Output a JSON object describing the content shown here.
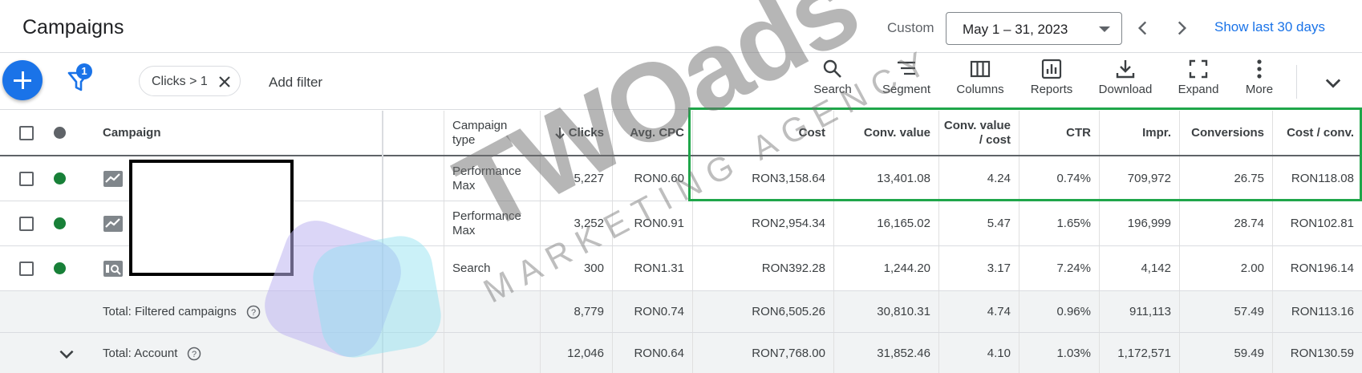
{
  "header": {
    "title": "Campaigns",
    "custom_label": "Custom",
    "date_range": "May 1 – 31, 2023",
    "show_last": "Show last 30 days"
  },
  "toolbar": {
    "filter_count": "1",
    "filter_chip": "Clicks > 1",
    "add_filter": "Add filter",
    "tools": [
      "Search",
      "Segment",
      "Columns",
      "Reports",
      "Download",
      "Expand",
      "More"
    ]
  },
  "table": {
    "headers": {
      "campaign": "Campaign",
      "campaign_type_line1": "Campaign",
      "campaign_type_line2": "type",
      "clicks": "Clicks",
      "avg_cpc": "Avg. CPC",
      "cost": "Cost",
      "conv_value": "Conv. value",
      "conv_value_cost_line1": "Conv. value",
      "conv_value_cost_line2": "/ cost",
      "ctr": "CTR",
      "impr": "Impr.",
      "conversions": "Conversions",
      "cost_conv": "Cost / conv."
    },
    "rows": [
      {
        "type_line1": "Performance",
        "type_line2": "Max",
        "clicks": "5,227",
        "avg_cpc": "RON0.60",
        "cost": "RON3,158.64",
        "conv_value": "13,401.08",
        "conv_value_cost": "4.24",
        "ctr": "0.74%",
        "impr": "709,972",
        "conversions": "26.75",
        "cost_conv": "RON118.08"
      },
      {
        "type_line1": "Performance",
        "type_line2": "Max",
        "clicks": "3,252",
        "avg_cpc": "RON0.91",
        "cost": "RON2,954.34",
        "conv_value": "16,165.02",
        "conv_value_cost": "5.47",
        "ctr": "1.65%",
        "impr": "196,999",
        "conversions": "28.74",
        "cost_conv": "RON102.81"
      },
      {
        "type_line1": "Search",
        "type_line2": "",
        "clicks": "300",
        "avg_cpc": "RON1.31",
        "cost": "RON392.28",
        "conv_value": "1,244.20",
        "conv_value_cost": "3.17",
        "ctr": "7.24%",
        "impr": "4,142",
        "conversions": "2.00",
        "cost_conv": "RON196.14"
      }
    ],
    "total_filtered": {
      "label": "Total: Filtered campaigns",
      "clicks": "8,779",
      "avg_cpc": "RON0.74",
      "cost": "RON6,505.26",
      "conv_value": "30,810.31",
      "conv_value_cost": "4.74",
      "ctr": "0.96%",
      "impr": "911,113",
      "conversions": "57.49",
      "cost_conv": "RON113.16"
    },
    "total_account": {
      "label": "Total: Account",
      "clicks": "12,046",
      "avg_cpc": "RON0.64",
      "cost": "RON7,768.00",
      "conv_value": "31,852.46",
      "conv_value_cost": "4.10",
      "ctr": "1.03%",
      "impr": "1,172,571",
      "conversions": "59.49",
      "cost_conv": "RON130.59"
    }
  },
  "watermark": {
    "main": "TWOads",
    "sub": "MARKETING AGENCY"
  },
  "colors": {
    "accent": "#1a73e8",
    "enabled": "#188038",
    "highlight": "#1fa64a"
  }
}
